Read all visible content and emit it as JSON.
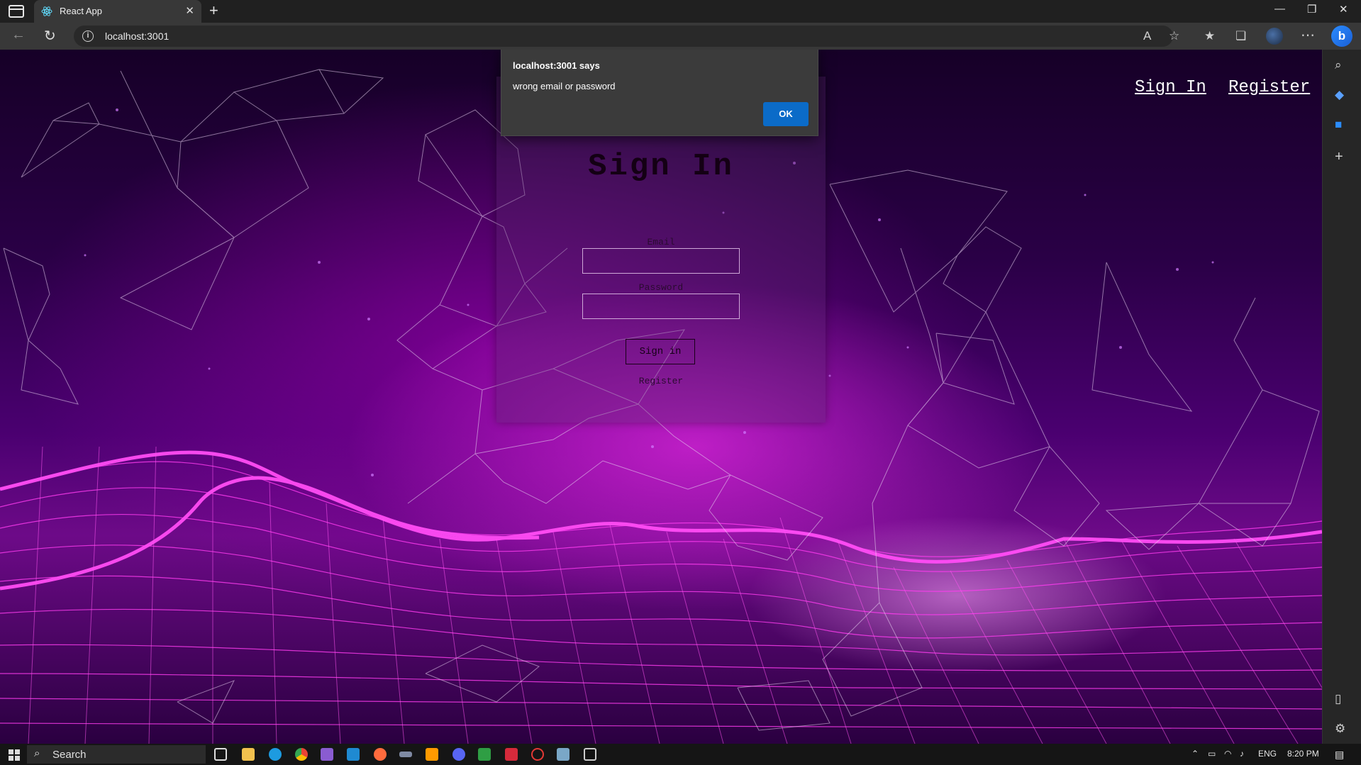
{
  "browser": {
    "tab_title": "React App",
    "url": "localhost:3001",
    "new_tab_symbol": "+",
    "tab_close_symbol": "✕"
  },
  "page": {
    "nav": {
      "sign_in": "Sign In",
      "register": "Register"
    },
    "form": {
      "title": "Sign In",
      "email_label": "Email",
      "email_value": "",
      "password_label": "Password",
      "password_value": "",
      "submit_label": "Sign in",
      "register_link": "Register"
    }
  },
  "alert": {
    "title": "localhost:3001 says",
    "message": "wrong email or password",
    "ok_label": "OK"
  },
  "taskbar": {
    "search_placeholder": "Search",
    "language": "ENG",
    "time": "8:20 PM"
  },
  "colors": {
    "accent_button": "#0b6bc8",
    "background_magenta": "#ff2ee6",
    "background_dark": "#160027"
  }
}
